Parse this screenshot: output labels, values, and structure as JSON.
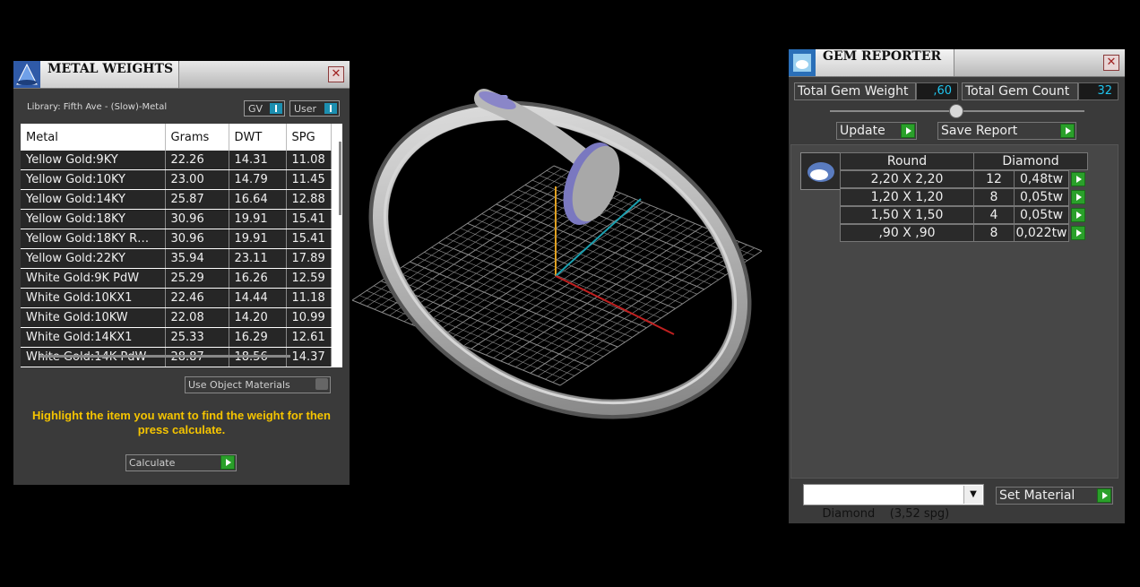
{
  "metal_weights": {
    "title": "METAL WEIGHTS",
    "library": "Library: Fifth Ave - (Slow)-Metal",
    "toggle_gv": "GV",
    "toggle_user": "User",
    "columns": [
      "Metal",
      "Grams",
      "DWT",
      "SPG"
    ],
    "rows": [
      [
        "Yellow Gold:9KY",
        "22.26",
        "14.31",
        "11.08"
      ],
      [
        "Yellow Gold:10KY",
        "23.00",
        "14.79",
        "11.45"
      ],
      [
        "Yellow Gold:14KY",
        "25.87",
        "16.64",
        "12.88"
      ],
      [
        "Yellow Gold:18KY",
        "30.96",
        "19.91",
        "15.41"
      ],
      [
        "Yellow Gold:18KY R…",
        "30.96",
        "19.91",
        "15.41"
      ],
      [
        "Yellow Gold:22KY",
        "35.94",
        "23.11",
        "17.89"
      ],
      [
        "White Gold:9K PdW",
        "25.29",
        "16.26",
        "12.59"
      ],
      [
        "White Gold:10KX1",
        "22.46",
        "14.44",
        "11.18"
      ],
      [
        "White Gold:10KW",
        "22.08",
        "14.20",
        "10.99"
      ],
      [
        "White Gold:14KX1",
        "25.33",
        "16.29",
        "12.61"
      ],
      [
        "White Gold:14K PdW",
        "28.87",
        "18.56",
        "14.37"
      ]
    ],
    "use_object_materials": "Use Object Materials",
    "hint": "Highlight the item you want to find the weight for then press calculate.",
    "calculate": "Calculate"
  },
  "gem_reporter": {
    "title": "GEM REPORTER",
    "total_weight_label": "Total Gem Weight",
    "total_weight_value": ",60",
    "total_count_label": "Total Gem Count",
    "total_count_value": "32",
    "update": "Update",
    "save_report": "Save Report",
    "header_shape": "Round",
    "header_material": "Diamond",
    "gems": [
      {
        "size": "2,20 X 2,20",
        "count": "12",
        "weight": "0,48tw"
      },
      {
        "size": "1,20 X 1,20",
        "count": "8",
        "weight": "0,05tw"
      },
      {
        "size": "1,50 X 1,50",
        "count": "4",
        "weight": "0,05tw"
      },
      {
        "size": ",90 X ,90",
        "count": "8",
        "weight": "0,022tw"
      }
    ],
    "material_select": "Diamond    (3,52 spg)",
    "set_material": "Set Material"
  },
  "colors": {
    "accent_cyan": "#1fc4ee",
    "hint_yellow": "#f5c400",
    "green": "#2aa02a",
    "panel": "#3a3a3a"
  }
}
